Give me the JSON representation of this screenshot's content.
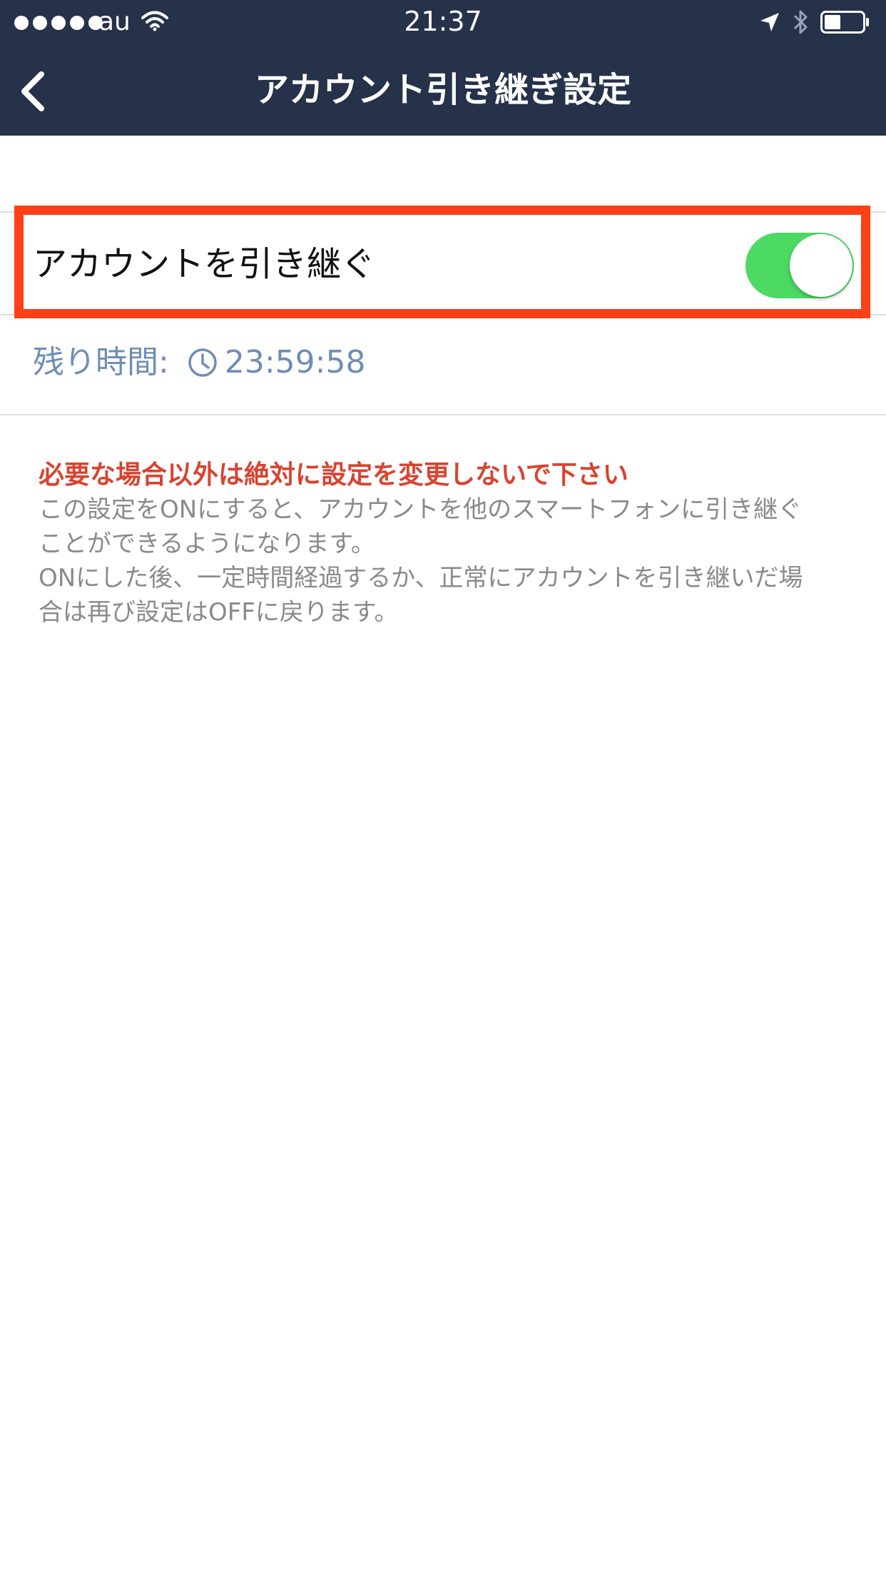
{
  "status_bar": {
    "carrier": "au",
    "time": "21:37",
    "signal_bars": 5
  },
  "nav": {
    "title": "アカウント引き継ぎ設定",
    "back_icon": "chevron-left-icon"
  },
  "toggle": {
    "label": "アカウントを引き継ぐ",
    "state": true,
    "on_color": "#4cd964"
  },
  "remaining": {
    "label": "残り時間:",
    "time": "23:59:58",
    "icon": "clock-icon"
  },
  "notes": {
    "warning": "必要な場合以外は絶対に設定を変更しないで下さい",
    "description": "この設定をONにすると、アカウントを他のスマートフォンに引き継ぐ\nことができるようになります。\nONにした後、一定時間経過するか、正常にアカウントを引き継いだ場\n合は再び設定はOFFに戻ります。"
  },
  "colors": {
    "navbar": "#26314a",
    "highlight": "#ff3f17",
    "warning": "#d9432f",
    "remaining": "#6f8db5"
  }
}
